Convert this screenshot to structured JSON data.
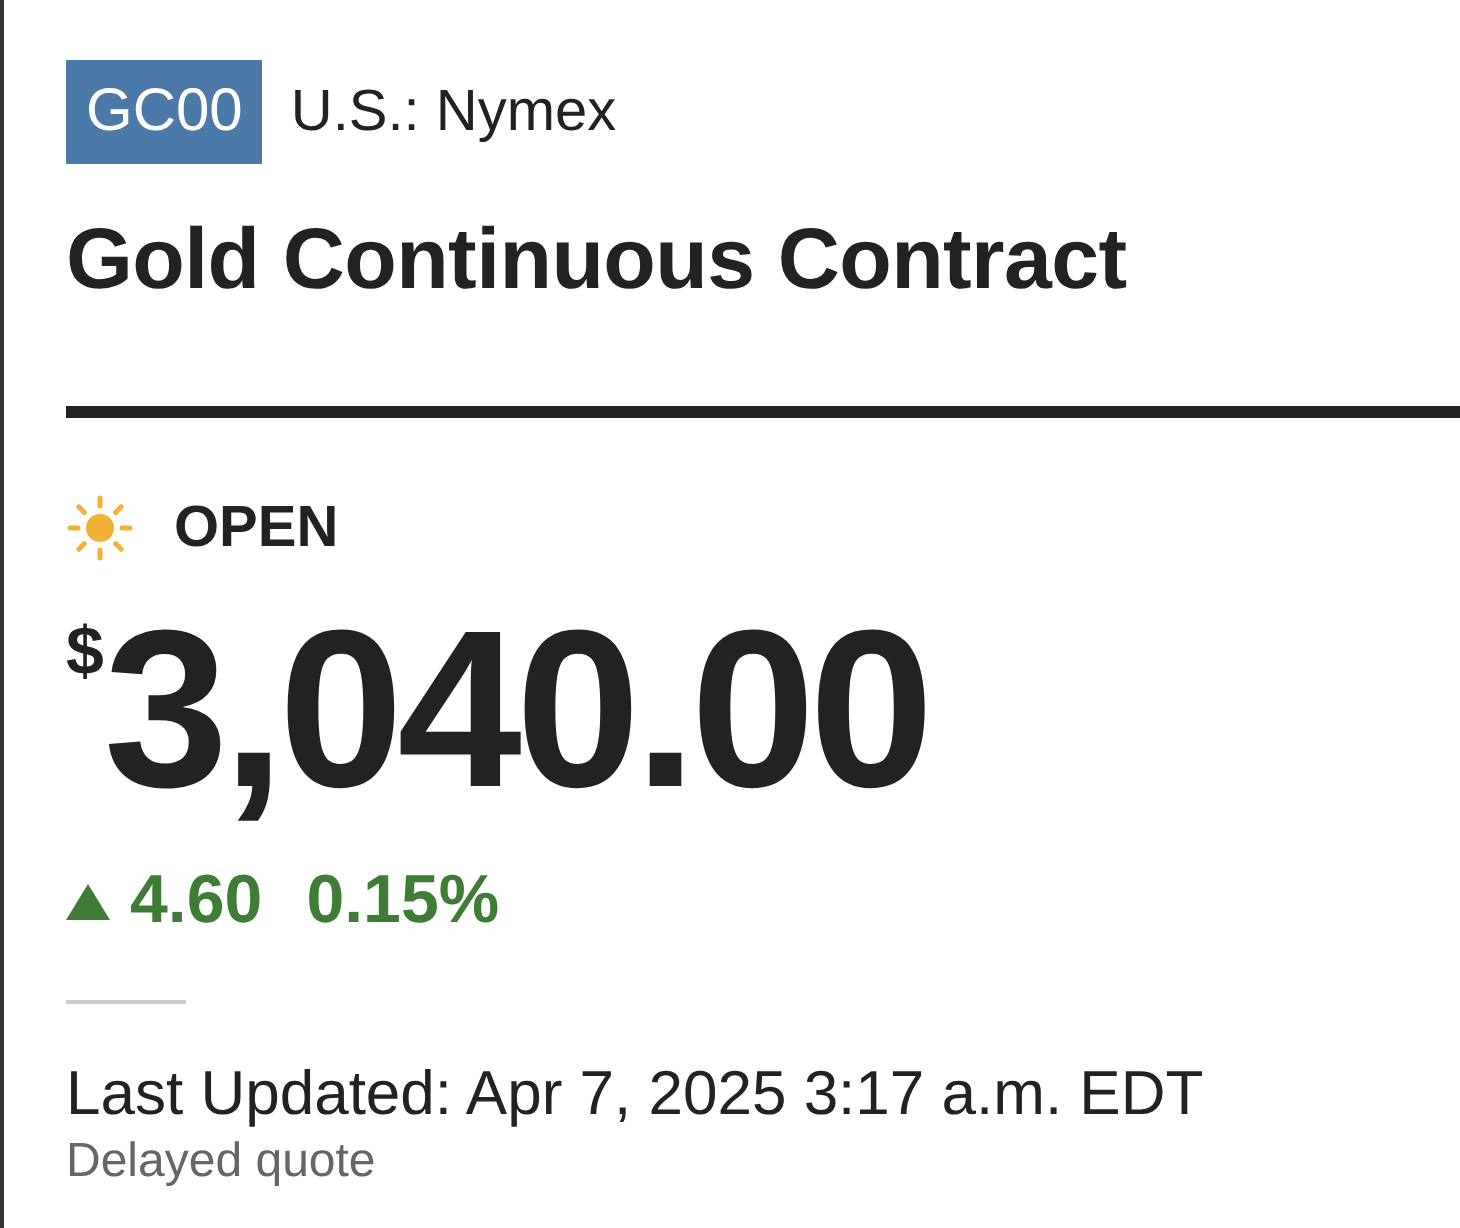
{
  "ticker": "GC00",
  "exchange": "U.S.: Nymex",
  "title": "Gold Continuous Contract",
  "market_status": {
    "kind": "open",
    "label": "OPEN"
  },
  "price": {
    "currency": "$",
    "value": "3,040.00"
  },
  "change": {
    "rising": true,
    "amount": "4.60",
    "percent": "0.15%"
  },
  "last_updated": "Last Updated: Apr 7, 2025 3:17 a.m. EDT",
  "note": "Delayed quote"
}
